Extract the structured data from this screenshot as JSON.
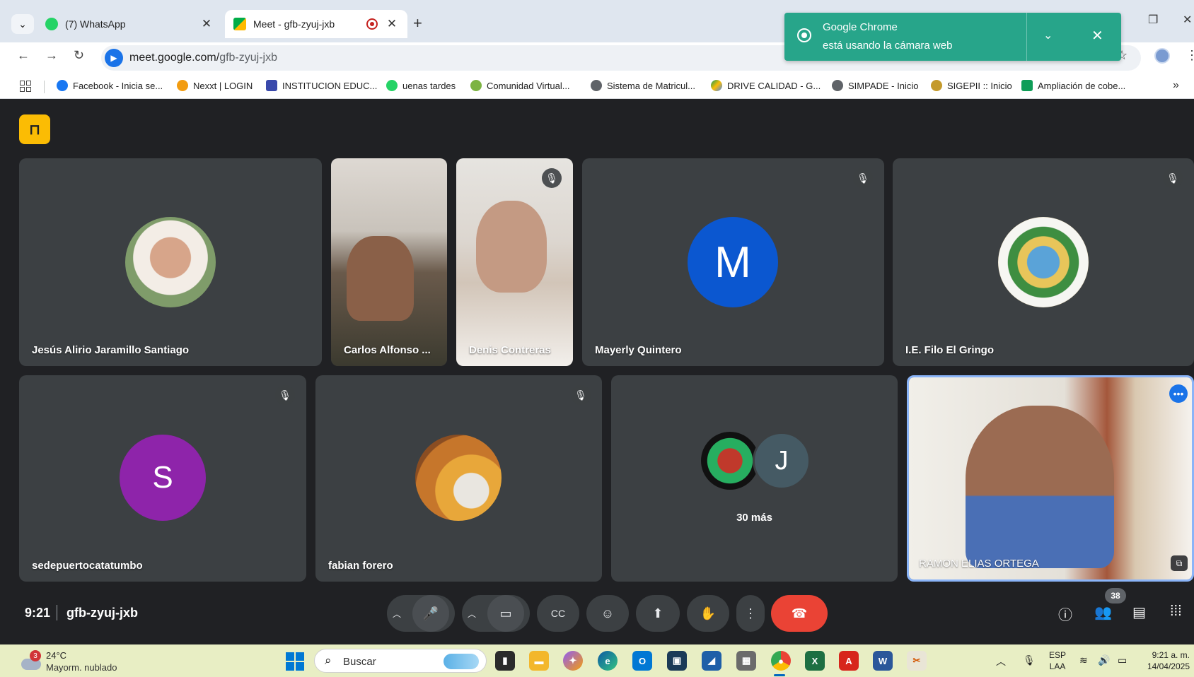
{
  "browser": {
    "tabs": [
      {
        "title": "(7) WhatsApp",
        "active": false
      },
      {
        "title": "Meet - gfb-zyuj-jxb",
        "active": true
      }
    ],
    "url_domain": "meet.google.com/",
    "url_path": "gfb-zyuj-jxb",
    "bookmarks": [
      "Facebook - Inicia se...",
      "Nexxt | LOGIN",
      "INSTITUCION EDUC...",
      "uenas tardes",
      "Comunidad Virtual...",
      "Sistema de Matricul...",
      "DRIVE CALIDAD - G...",
      "SIMPADE - Inicio",
      "SIGEPII :: Inicio",
      "Ampliación de cobe..."
    ]
  },
  "notification": {
    "app": "Google Chrome",
    "message": "está usando la cámara web"
  },
  "meeting": {
    "participants": [
      {
        "name": "Jesús Alirio Jaramillo Santiago",
        "type": "photo-avatar",
        "muted": false
      },
      {
        "name": "Carlos Alfonso ...",
        "type": "video",
        "muted": false
      },
      {
        "name": "Denis Contreras",
        "type": "video",
        "muted": true
      },
      {
        "name": "Mayerly Quintero",
        "type": "letter-avatar",
        "letter": "M",
        "color": "#0b57d0",
        "muted": true
      },
      {
        "name": "I.E. Filo El Gringo",
        "type": "logo-avatar",
        "muted": true
      },
      {
        "name": "sedepuertocatatumbo",
        "type": "letter-avatar",
        "letter": "S",
        "color": "#8e24aa",
        "muted": true
      },
      {
        "name": "fabian forero",
        "type": "photo-avatar",
        "muted": true
      },
      {
        "name": "RAMON ELIAS ORTEGA",
        "type": "video",
        "self": true
      }
    ],
    "others": {
      "letter": "J",
      "label": "30 más"
    },
    "time": "9:21",
    "code": "gfb-zyuj-jxb",
    "people_count": "38"
  },
  "taskbar": {
    "weather_badge": "3",
    "temperature": "24°C",
    "condition": "Mayorm. nublado",
    "search_placeholder": "Buscar",
    "lang_line1": "ESP",
    "lang_line2": "LAA",
    "time": "9:21 a. m.",
    "date": "14/04/2025"
  },
  "colors": {
    "meet_bg": "#202124",
    "tile_bg": "#3c4043",
    "end_call": "#ea4335",
    "notification": "#27a58a"
  }
}
